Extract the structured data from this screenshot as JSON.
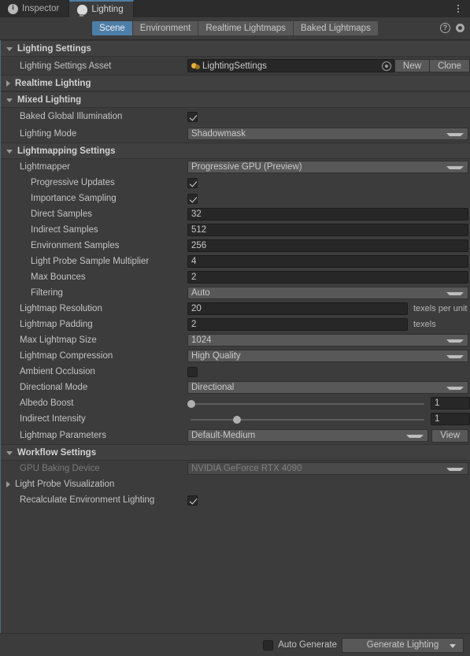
{
  "window": {
    "tabs": [
      {
        "label": "Inspector",
        "icon": "info-icon",
        "active": false
      },
      {
        "label": "Lighting",
        "icon": "lightbulb-icon",
        "active": true
      }
    ],
    "menu_icon": "kebab-menu-icon"
  },
  "toolbar": {
    "tabs": [
      {
        "label": "Scene",
        "active": true
      },
      {
        "label": "Environment",
        "active": false
      },
      {
        "label": "Realtime Lightmaps",
        "active": false
      },
      {
        "label": "Baked Lightmaps",
        "active": false
      }
    ],
    "help_icon": "help-icon",
    "settings_icon": "gear-icon"
  },
  "sections": {
    "lighting_settings": {
      "title": "Lighting Settings",
      "asset_label": "Lighting Settings Asset",
      "asset_value": "LightingSettings",
      "new_button": "New",
      "clone_button": "Clone"
    },
    "realtime_lighting": {
      "title": "Realtime Lighting"
    },
    "mixed_lighting": {
      "title": "Mixed Lighting",
      "baked_gi_label": "Baked Global Illumination",
      "baked_gi_checked": true,
      "lighting_mode_label": "Lighting Mode",
      "lighting_mode_value": "Shadowmask"
    },
    "lightmapping_settings": {
      "title": "Lightmapping Settings",
      "lightmapper_label": "Lightmapper",
      "lightmapper_value": "Progressive GPU (Preview)",
      "progressive_updates_label": "Progressive Updates",
      "progressive_updates_checked": true,
      "importance_sampling_label": "Importance Sampling",
      "importance_sampling_checked": true,
      "direct_samples_label": "Direct Samples",
      "direct_samples_value": "32",
      "indirect_samples_label": "Indirect Samples",
      "indirect_samples_value": "512",
      "environment_samples_label": "Environment Samples",
      "environment_samples_value": "256",
      "light_probe_sample_multiplier_label": "Light Probe Sample Multiplier",
      "light_probe_sample_multiplier_value": "4",
      "max_bounces_label": "Max Bounces",
      "max_bounces_value": "2",
      "filtering_label": "Filtering",
      "filtering_value": "Auto",
      "lightmap_resolution_label": "Lightmap Resolution",
      "lightmap_resolution_value": "20",
      "lightmap_resolution_unit": "texels per unit",
      "lightmap_padding_label": "Lightmap Padding",
      "lightmap_padding_value": "2",
      "lightmap_padding_unit": "texels",
      "max_lightmap_size_label": "Max Lightmap Size",
      "max_lightmap_size_value": "1024",
      "lightmap_compression_label": "Lightmap Compression",
      "lightmap_compression_value": "High Quality",
      "ambient_occlusion_label": "Ambient Occlusion",
      "ambient_occlusion_checked": false,
      "directional_mode_label": "Directional Mode",
      "directional_mode_value": "Directional",
      "albedo_boost_label": "Albedo Boost",
      "albedo_boost_value": "1",
      "albedo_boost_percent": 0,
      "indirect_intensity_label": "Indirect Intensity",
      "indirect_intensity_value": "1",
      "indirect_intensity_percent": 20,
      "lightmap_parameters_label": "Lightmap Parameters",
      "lightmap_parameters_value": "Default-Medium",
      "lightmap_parameters_view_button": "View"
    },
    "workflow_settings": {
      "title": "Workflow Settings",
      "gpu_baking_device_label": "GPU Baking Device",
      "gpu_baking_device_value": "NVIDIA GeForce RTX 4090",
      "light_probe_visualization_label": "Light Probe Visualization",
      "recalculate_env_lighting_label": "Recalculate Environment Lighting",
      "recalculate_env_lighting_checked": true
    }
  },
  "footer": {
    "auto_generate_label": "Auto Generate",
    "auto_generate_checked": false,
    "generate_button": "Generate Lighting"
  },
  "colors": {
    "accent_blue": "#4d7ea8",
    "panel_bg": "#3c3c3c",
    "header_bg": "#404040",
    "field_bg": "#272727",
    "dropdown_bg": "#585858",
    "asset_icon": "#e8b23a"
  }
}
